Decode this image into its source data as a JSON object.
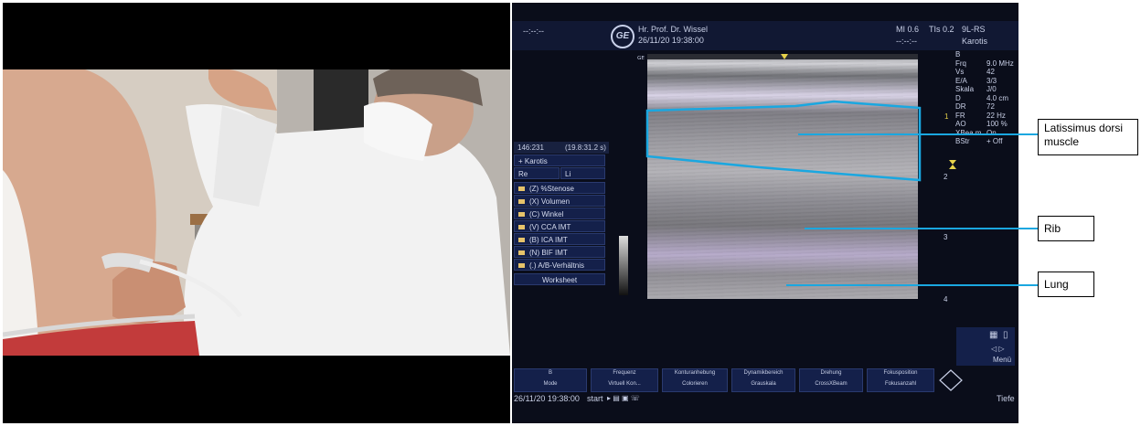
{
  "ultrasound": {
    "top_left_placeholder": "--:--:--",
    "operator": "Hr. Prof. Dr. Wissel",
    "datetime": "26/11/20 19:38:00",
    "mi": "MI 0.6",
    "tis": "TIs 0.2",
    "probe": "9L-RS",
    "time_placeholder": "--:--:--",
    "preset": "Karotis",
    "scan_params": [
      {
        "k": "B",
        "v": ""
      },
      {
        "k": "Frq",
        "v": "9.0 MHz"
      },
      {
        "k": "Vs",
        "v": "42"
      },
      {
        "k": "E/A",
        "v": "3/3"
      },
      {
        "k": "Skala",
        "v": "J/0"
      },
      {
        "k": "D",
        "v": "4.0 cm"
      },
      {
        "k": "DR",
        "v": "72"
      },
      {
        "k": "FR",
        "v": "22 Hz"
      },
      {
        "k": "AO",
        "v": "100 %"
      },
      {
        "k": "XBea m",
        "v": "On"
      },
      {
        "k": "BStr",
        "v": "+ Off"
      }
    ],
    "focus_marker": "1",
    "depth_ticks": [
      "2",
      "3",
      "4"
    ],
    "coords": "146:231",
    "cine": "(19.8:31.2 s)",
    "menu_title": "Karotis",
    "side_re": "Re",
    "side_li": "Li",
    "menu_items": [
      "(Z) %Stenose",
      "(X) Volumen",
      "(C) Winkel",
      "(V) CCA IMT",
      "(B) ICA IMT",
      "(N) BIF IMT",
      "(.) A/B-Verhältnis"
    ],
    "worksheet": "Worksheet",
    "menu_label": "Menü",
    "bottom_tabs": [
      {
        "top": "B",
        "bottom": "Mode"
      },
      {
        "top": "Frequenz",
        "bottom": "Virtuell Kon..."
      },
      {
        "top": "Konturanhebung",
        "bottom": "Colorieren"
      },
      {
        "top": "Dynamikbereich",
        "bottom": "Grauskala"
      },
      {
        "top": "Drehung",
        "bottom": "CrossXBeam"
      },
      {
        "top": "Fokusposition",
        "bottom": "Fokusanzahl"
      }
    ],
    "status_datetime": "26/11/20 19:38:00",
    "start": "start",
    "tiefe": "Tiefe"
  },
  "annotations": {
    "latissimus": "Latissimus dorsi muscle",
    "rib": "Rib",
    "lung": "Lung"
  },
  "colors": {
    "pointer": "#1aa7e0",
    "screen_bg": "#0a0d1a"
  }
}
